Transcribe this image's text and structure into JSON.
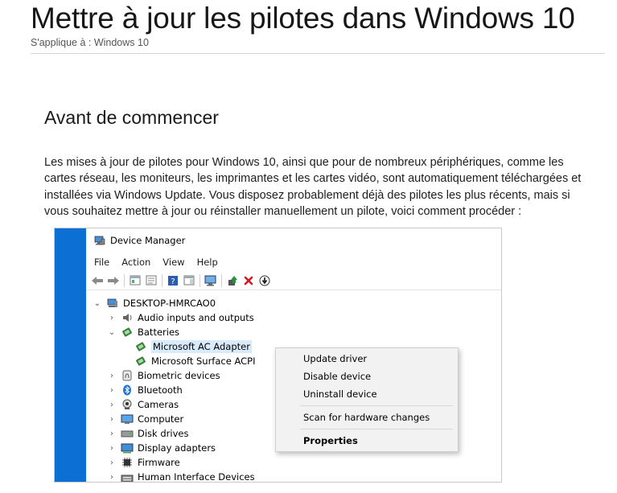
{
  "header": {
    "title": "Mettre à jour les pilotes dans Windows 10",
    "applies_to": "S'applique à : Windows 10"
  },
  "section": {
    "title": "Avant de commencer",
    "paragraph_lines": [
      "Les mises à jour de pilotes pour Windows 10, ainsi que pour de nombreux périphériques, comme les",
      "cartes réseau, les moniteurs, les imprimantes et les cartes vidéo, sont automatiquement téléchargées et",
      "installées via Windows Update. Vous disposez probablement déjà des pilotes les plus récents, mais si",
      "vous souhaitez mettre à jour ou réinstaller manuellement un pilote, voici comment procéder :"
    ]
  },
  "device_manager": {
    "title": "Device Manager",
    "menu": [
      "File",
      "Action",
      "View",
      "Help"
    ],
    "toolbar_icons": [
      "back-icon",
      "forward-icon",
      "properties-icon",
      "show-hidden-icon",
      "help-icon",
      "console-icon",
      "scan-icon",
      "update-driver-icon",
      "uninstall-icon",
      "disable-icon"
    ],
    "tree": {
      "root": "DESKTOP-HMRCAO0",
      "items": [
        {
          "label": "Audio inputs and outputs",
          "icon": "speaker-icon",
          "expanded": false
        },
        {
          "label": "Batteries",
          "icon": "battery-icon",
          "expanded": true,
          "children": [
            "Microsoft AC Adapter",
            "Microsoft Surface ACPI-Compliant Control Method Battery"
          ]
        },
        {
          "label": "Biometric devices",
          "icon": "fingerprint-icon",
          "expanded": false
        },
        {
          "label": "Bluetooth",
          "icon": "bluetooth-icon",
          "expanded": false
        },
        {
          "label": "Cameras",
          "icon": "camera-icon",
          "expanded": false
        },
        {
          "label": "Computer",
          "icon": "computer-icon",
          "expanded": false
        },
        {
          "label": "Disk drives",
          "icon": "disk-icon",
          "expanded": false
        },
        {
          "label": "Display adapters",
          "icon": "display-icon",
          "expanded": false
        },
        {
          "label": "Firmware",
          "icon": "firmware-icon",
          "expanded": false
        },
        {
          "label": "Human Interface Devices",
          "icon": "hid-icon",
          "expanded": false
        }
      ],
      "visible_child_2": "Microsoft Surface ACPI"
    },
    "context_menu": {
      "items": [
        "Update driver",
        "Disable device",
        "Uninstall device",
        "Scan for hardware changes",
        "Properties"
      ]
    }
  }
}
